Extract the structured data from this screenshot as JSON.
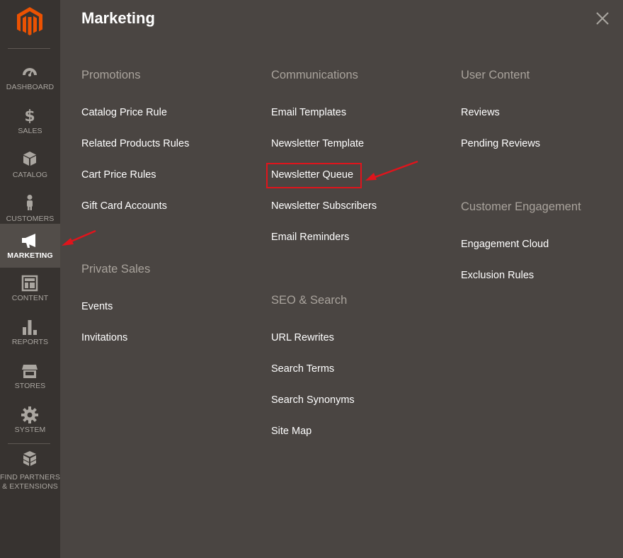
{
  "sidebar": {
    "items": [
      {
        "label": "Dashboard",
        "icon": "dashboard-icon"
      },
      {
        "label": "Sales",
        "icon": "dollar-icon"
      },
      {
        "label": "Catalog",
        "icon": "box-icon"
      },
      {
        "label": "Customers",
        "icon": "person-icon"
      },
      {
        "label": "Marketing",
        "icon": "megaphone-icon"
      },
      {
        "label": "Content",
        "icon": "layout-icon"
      },
      {
        "label": "Reports",
        "icon": "bar-chart-icon"
      },
      {
        "label": "Stores",
        "icon": "storefront-icon"
      },
      {
        "label": "System",
        "icon": "gear-icon"
      }
    ],
    "partners_line1": "Find Partners",
    "partners_line2": "& Extensions"
  },
  "panel": {
    "title": "Marketing",
    "columns": [
      {
        "groups": [
          {
            "title": "Promotions",
            "links": [
              "Catalog Price Rule",
              "Related Products Rules",
              "Cart Price Rules",
              "Gift Card Accounts"
            ]
          },
          {
            "title": "Private Sales",
            "links": [
              "Events",
              "Invitations"
            ]
          }
        ]
      },
      {
        "groups": [
          {
            "title": "Communications",
            "links": [
              "Email Templates",
              "Newsletter Template",
              "Newsletter Queue",
              "Newsletter Subscribers",
              "Email Reminders"
            ]
          },
          {
            "title": "SEO & Search",
            "links": [
              "URL Rewrites",
              "Search Terms",
              "Search Synonyms",
              "Site Map"
            ]
          }
        ]
      },
      {
        "groups": [
          {
            "title": "User Content",
            "links": [
              "Reviews",
              "Pending Reviews"
            ]
          },
          {
            "title": "Customer Engagement",
            "links": [
              "Engagement Cloud",
              "Exclusion Rules"
            ]
          }
        ]
      }
    ]
  },
  "colors": {
    "sidebar": "#373330",
    "panel": "#4a4542",
    "accent": "#eb5202",
    "annotation": "#e0141c"
  }
}
